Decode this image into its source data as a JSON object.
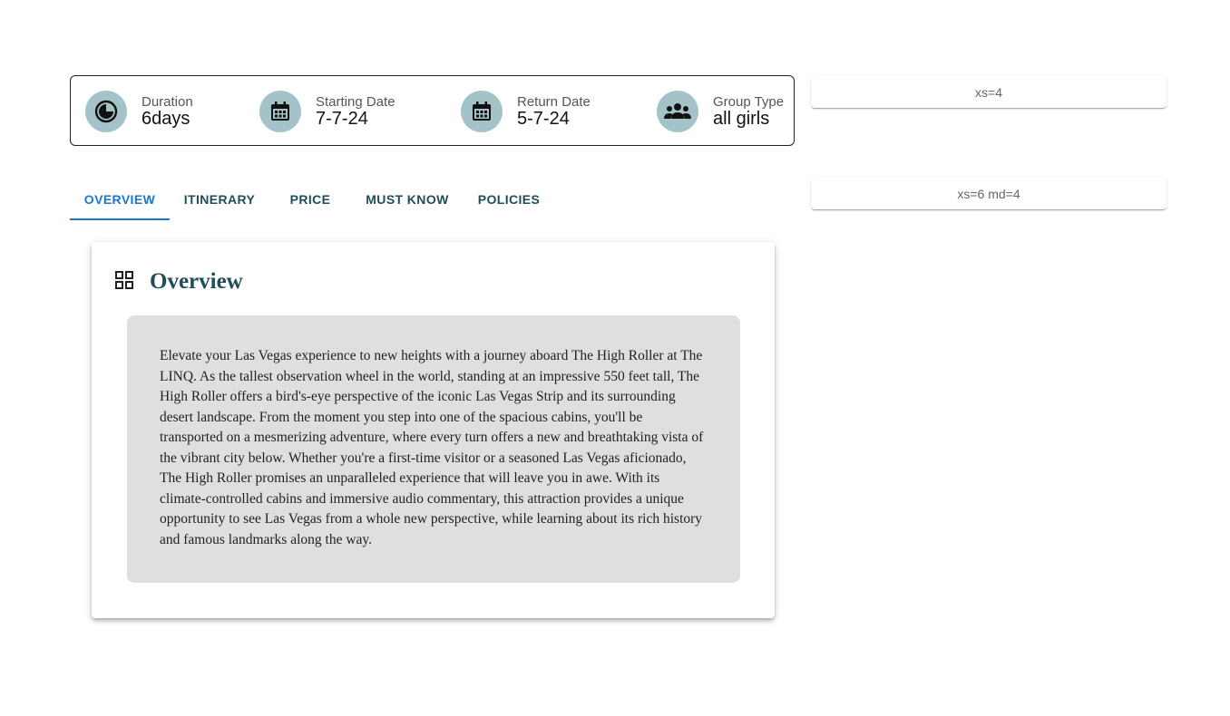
{
  "info": {
    "duration": {
      "label": "Duration",
      "value": "6days",
      "icon": "clock-icon"
    },
    "start": {
      "label": "Starting Date",
      "value": "7-7-24",
      "icon": "calendar-icon"
    },
    "return": {
      "label": "Return Date",
      "value": "5-7-24",
      "icon": "calendar-icon"
    },
    "group": {
      "label": "Group Type",
      "value": "all girls",
      "icon": "groups-icon"
    },
    "icon_bg": "#a4c3c8"
  },
  "side": {
    "box1": "xs=4",
    "box2": "xs=6 md=4"
  },
  "tabs": [
    {
      "label": "OVERVIEW",
      "active": true
    },
    {
      "label": "ITINERARY",
      "active": false
    },
    {
      "label": "PRICE",
      "active": false
    },
    {
      "label": "MUST KNOW",
      "active": false
    },
    {
      "label": "POLICIES",
      "active": false
    }
  ],
  "overview": {
    "title": "Overview",
    "text": "Elevate your Las Vegas experience to new heights with a journey aboard The High Roller at The LINQ. As the tallest observation wheel in the world, standing at an impressive 550 feet tall, The High Roller offers a bird's-eye perspective of the iconic Las Vegas Strip and its surrounding desert landscape. From the moment you step into one of the spacious cabins, you'll be transported on a mesmerizing adventure, where every turn offers a new and breathtaking vista of the vibrant city below. Whether you're a first-time visitor or a seasoned Las Vegas aficionado, The High Roller promises an unparalleled experience that will leave you in awe. With its climate-controlled cabins and immersive audio commentary, this attraction provides a unique opportunity to see Las Vegas from a whole new perspective, while learning about its rich history and famous landmarks along the way."
  },
  "colors": {
    "accent": "#1976d2",
    "tab_text": "#1f4d5a",
    "body_bg": "#dfdfdf"
  }
}
